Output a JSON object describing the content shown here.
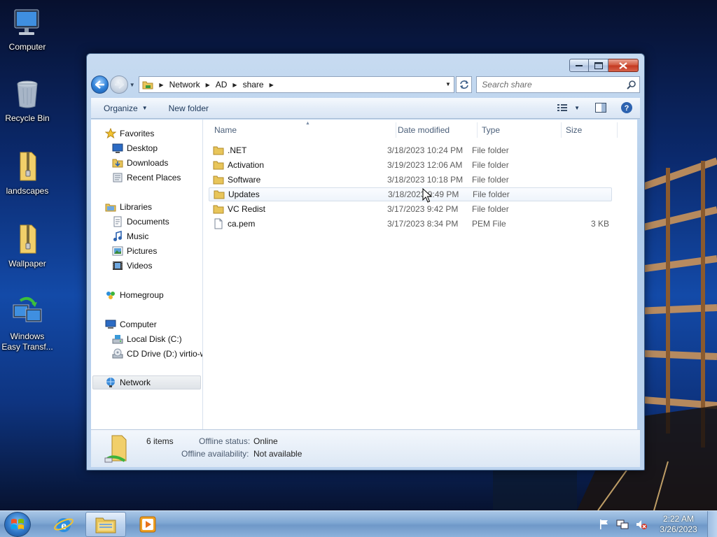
{
  "desktop": {
    "icons": [
      {
        "label": "Computer",
        "icon": "computer-icon"
      },
      {
        "label": "Recycle Bin",
        "icon": "recycle-bin-icon"
      },
      {
        "label": "landscapes",
        "icon": "zip-folder-icon"
      },
      {
        "label": "Wallpaper",
        "icon": "zip-folder-icon"
      },
      {
        "label": "Windows Easy Transf...",
        "icon": "easy-transfer-icon"
      }
    ]
  },
  "window": {
    "address": {
      "crumbs": [
        "Network",
        "AD",
        "share"
      ]
    },
    "search": {
      "placeholder": "Search share"
    },
    "toolbar": {
      "organize_label": "Organize",
      "new_folder_label": "New folder"
    },
    "nav": {
      "favorites": {
        "label": "Favorites",
        "items": [
          "Desktop",
          "Downloads",
          "Recent Places"
        ]
      },
      "libraries": {
        "label": "Libraries",
        "items": [
          "Documents",
          "Music",
          "Pictures",
          "Videos"
        ]
      },
      "homegroup": {
        "label": "Homegroup"
      },
      "computer": {
        "label": "Computer",
        "items": [
          "Local Disk (C:)",
          "CD Drive (D:) virtio-w"
        ]
      },
      "network": {
        "label": "Network"
      }
    },
    "columns": {
      "name": "Name",
      "date": "Date modified",
      "type": "Type",
      "size": "Size"
    },
    "files": [
      {
        "name": ".NET",
        "date": "3/18/2023 10:24 PM",
        "type": "File folder",
        "size": "",
        "kind": "folder"
      },
      {
        "name": "Activation",
        "date": "3/19/2023 12:06 AM",
        "type": "File folder",
        "size": "",
        "kind": "folder"
      },
      {
        "name": "Software",
        "date": "3/18/2023 10:18 PM",
        "type": "File folder",
        "size": "",
        "kind": "folder"
      },
      {
        "name": "Updates",
        "date": "3/18/2023 9:49 PM",
        "type": "File folder",
        "size": "",
        "kind": "folder"
      },
      {
        "name": "VC Redist",
        "date": "3/17/2023 9:42 PM",
        "type": "File folder",
        "size": "",
        "kind": "folder"
      },
      {
        "name": "ca.pem",
        "date": "3/17/2023 8:34 PM",
        "type": "PEM File",
        "size": "3 KB",
        "kind": "file"
      }
    ],
    "details": {
      "count": "6 items",
      "offline_status_label": "Offline status:",
      "offline_status_value": "Online",
      "offline_avail_label": "Offline availability:",
      "offline_avail_value": "Not available"
    }
  },
  "taskbar": {
    "time": "2:22 AM",
    "date": "3/26/2023"
  },
  "colors": {
    "accent": "#2f76c6",
    "folder": "#e8c55a",
    "close": "#c3381f"
  }
}
